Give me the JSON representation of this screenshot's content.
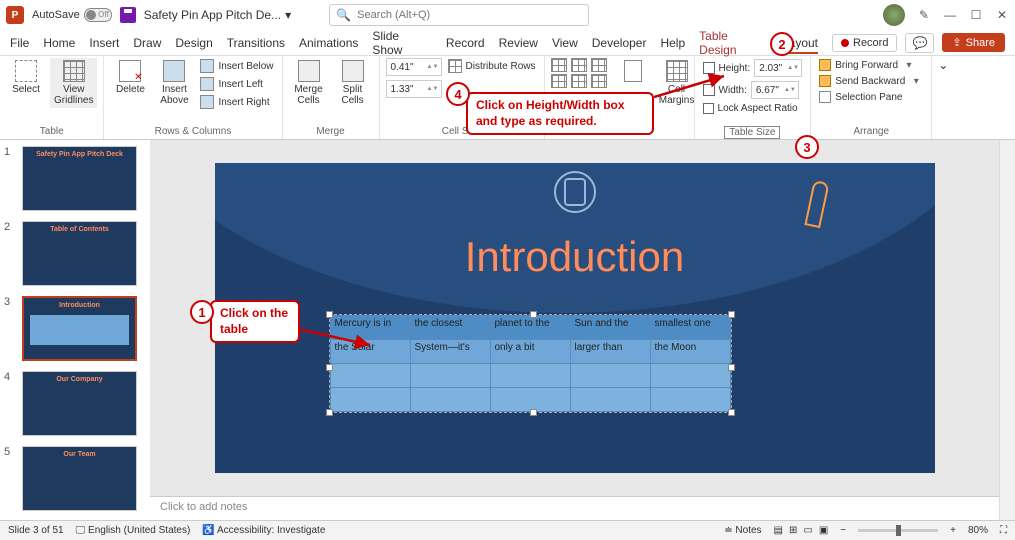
{
  "titlebar": {
    "autosave_label": "AutoSave",
    "autosave_state": "Off",
    "doc_title": "Safety Pin App Pitch De...",
    "search_placeholder": "Search (Alt+Q)"
  },
  "menu": {
    "items": [
      "File",
      "Home",
      "Insert",
      "Draw",
      "Design",
      "Transitions",
      "Animations",
      "Slide Show",
      "Record",
      "Review",
      "View",
      "Developer",
      "Help"
    ],
    "context_tabs": [
      "Table Design",
      "Layout"
    ],
    "active": "Layout",
    "record_btn": "Record",
    "share_btn": "Share"
  },
  "ribbon": {
    "table": {
      "select": "Select",
      "view_gridlines": "View\nGridlines",
      "group": "Table"
    },
    "rows_cols": {
      "delete": "Delete",
      "insert_above": "Insert\nAbove",
      "insert_below": "Insert Below",
      "insert_left": "Insert Left",
      "insert_right": "Insert Right",
      "group": "Rows & Columns"
    },
    "merge": {
      "merge_cells": "Merge\nCells",
      "split_cells": "Split\nCells",
      "group": "Merge"
    },
    "cellsize": {
      "dist_rows": "Distribute Rows",
      "h_val": "0.41\"",
      "w_val": "1.33\"",
      "group": "Cell Size"
    },
    "alignment": {
      "cell_margins": "Cell\nMargins"
    },
    "tablesize": {
      "height_label": "Height:",
      "height_val": "2.03\"",
      "width_label": "Width:",
      "width_val": "6.67\"",
      "lock": "Lock Aspect Ratio",
      "group": "Table Size"
    },
    "arrange": {
      "bring_forward": "Bring Forward",
      "send_backward": "Send Backward",
      "selection_pane": "Selection Pane",
      "group": "Arrange"
    }
  },
  "thumbs": {
    "titles": [
      "Safety Pin App Pitch Deck",
      "Table of Contents",
      "Introduction",
      "Our Company",
      "Our Team"
    ]
  },
  "slide": {
    "title": "Introduction",
    "table": [
      [
        "Mercury is in",
        "the closest",
        "planet to the",
        "Sun and the",
        "smallest one"
      ],
      [
        "the Solar",
        "System—it's",
        "only a bit",
        "larger than",
        "the Moon"
      ],
      [
        "",
        "",
        "",
        "",
        ""
      ],
      [
        "",
        "",
        "",
        "",
        ""
      ]
    ]
  },
  "notes_placeholder": "Click to add notes",
  "statusbar": {
    "slide_info": "Slide 3 of 51",
    "language": "English (United States)",
    "accessibility": "Accessibility: Investigate",
    "notes_btn": "Notes",
    "zoom": "80%"
  },
  "annotations": {
    "c1": "Click on the table",
    "c4": "Click on Height/Width box and type as required."
  }
}
